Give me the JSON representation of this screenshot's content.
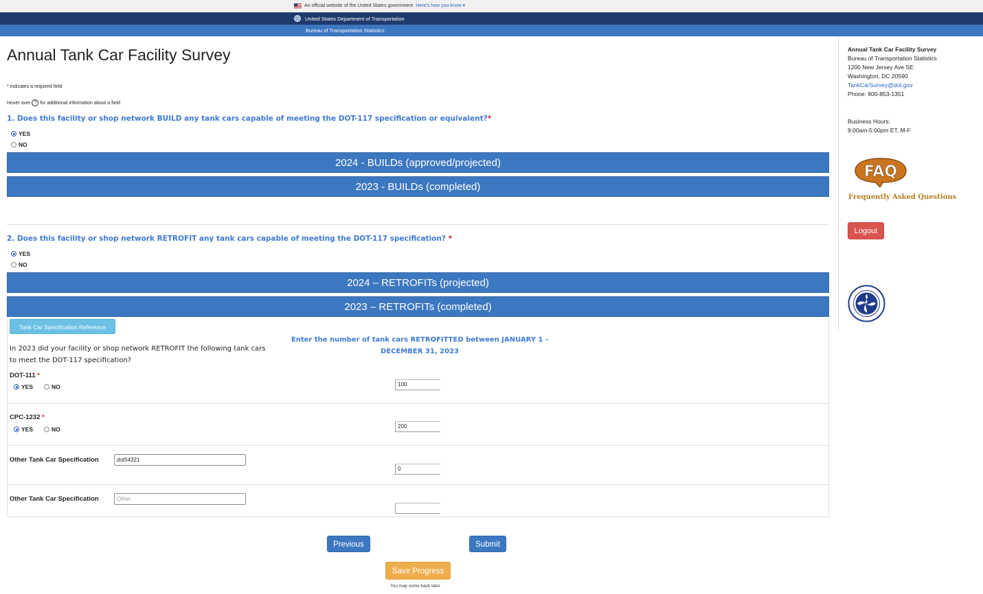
{
  "banner": {
    "official_text": "An official website of the United States government",
    "how_you_know": "Here's how you know",
    "chevron": "▾",
    "department": "United States Department of Transportation",
    "bureau": "Bureau of Transportation Statistics"
  },
  "page": {
    "title": "Annual Tank Car Facility Survey",
    "required_note_star": "*",
    "required_note": " indicates a required field",
    "hover_prefix": "Hover over",
    "hover_icon": "?",
    "hover_suffix": "for additional information about a field"
  },
  "q1": {
    "text": "1. Does this facility or shop network BUILD any tank cars capable of meeting the DOT-117 specification or equivalent?",
    "req": "*",
    "yes": "YES",
    "no": "NO",
    "selected": "YES",
    "section_2024": "2024 - BUILDs (approved/projected)",
    "section_2023": "2023 - BUILDs (completed)"
  },
  "q2": {
    "text": "2. Does this facility or shop network RETROFIT any tank cars capable of meeting the DOT-117 specification?",
    "req": " *",
    "yes": "YES",
    "no": "NO",
    "selected": "YES",
    "section_2024": "2024 – RETROFITs (projected)",
    "section_2023": "2023 – RETROFITs (completed)"
  },
  "retrofit_panel": {
    "spec_ref_button": "Tank Car Specification Reference",
    "question_text": "In 2023 did your facility or shop network RETROFIT the following tank cars to meet the DOT-117 specification?",
    "enter_text": "Enter the number of tank cars RETROFITTED between JANUARY 1 - DECEMBER 31, 2023",
    "rows": [
      {
        "label": "DOT-111",
        "req": " *",
        "yes": "YES",
        "no": "NO",
        "selected": "YES",
        "value": "100"
      },
      {
        "label": "CPC-1232",
        "req": " *",
        "yes": "YES",
        "no": "NO",
        "selected": "YES",
        "value": "200"
      }
    ],
    "other_rows": [
      {
        "label": "Other Tank Car Specification",
        "text_value": "dot54321",
        "placeholder": "",
        "value": "0"
      },
      {
        "label": "Other Tank Car Specification",
        "text_value": "",
        "placeholder": "Other",
        "value": ""
      }
    ]
  },
  "buttons": {
    "previous": "Previous",
    "submit": "Submit",
    "save": "Save Progress",
    "save_note": "You may come back later"
  },
  "sidebar": {
    "title": "Annual Tank Car Facility Survey",
    "org": "Bureau of Transportation Statistics",
    "address1": "1200 New Jersey Ave SE",
    "address2": "Washington, DC 20590",
    "email": "TankCarSurvey@dot.gov",
    "phone": "Phone: 800-853-1351",
    "hours_label": "Business Hours:",
    "hours": "9:00am-5:00pm ET, M-F",
    "faq_logo": "FAQ",
    "faq_text": "Frequently Asked Questions",
    "logout": "Logout"
  }
}
